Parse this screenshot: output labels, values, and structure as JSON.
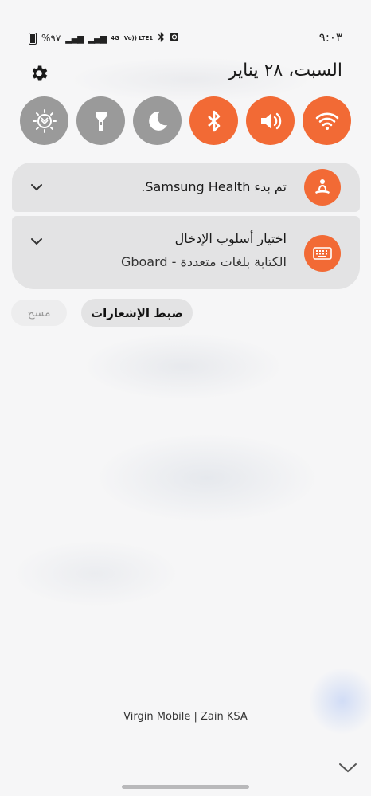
{
  "status_bar": {
    "time": "٩:٠٣",
    "battery": "%٩٧",
    "network_4g": "4G",
    "volte": "Vo)) LTE1"
  },
  "header": {
    "date": "السبت، ٢٨ يناير"
  },
  "quick_tiles": [
    {
      "name": "wifi",
      "icon": "wifi-icon",
      "state": "on"
    },
    {
      "name": "sound",
      "icon": "speaker-icon",
      "state": "on"
    },
    {
      "name": "bluetooth",
      "icon": "bluetooth-icon",
      "state": "on"
    },
    {
      "name": "dark-mode",
      "icon": "moon-icon",
      "state": "off"
    },
    {
      "name": "flashlight",
      "icon": "flashlight-icon",
      "state": "off"
    },
    {
      "name": "eye-comfort",
      "icon": "eye-comfort-icon",
      "state": "off"
    }
  ],
  "notifications": [
    {
      "title": "تم بدء Samsung Health.",
      "app_icon": "meditation-icon"
    },
    {
      "title": "اختيار أسلوب الإدخال",
      "subtitle": "الكتابة بلغات متعددة - Gboard",
      "app_icon": "keyboard-icon"
    }
  ],
  "actions": {
    "notification_settings": "ضبط الإشعارات",
    "clear": "مسح"
  },
  "carrier": "Virgin Mobile | Zain KSA",
  "colors": {
    "accent": "#f26a35",
    "tile_off": "#9a9a9a",
    "card_bg": "#e3e3e4"
  }
}
